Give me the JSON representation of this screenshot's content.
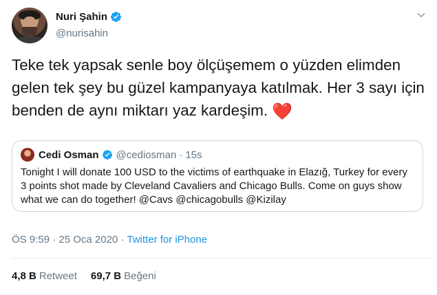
{
  "author": {
    "display_name": "Nuri Şahin",
    "handle": "@nurisahin"
  },
  "tweet": {
    "text": "Teke tek yapsak senle boy ölçüşemem o yüzden elimden gelen tek şey bu güzel kampanyaya katılmak. Her 3 sayı için benden de aynı miktarı yaz kardeşim.",
    "emoji": "❤️"
  },
  "quoted": {
    "display_name": "Cedi Osman",
    "handle": "@cediosman",
    "separator": "·",
    "time": "15s",
    "text": "Tonight I will donate 100 USD to the victims of earthquake in Elazığ, Turkey for every 3 points shot made by Cleveland Cavaliers and Chicago Bulls. Come on guys show what we can do together! @Cavs @chicagobulls @Kizilay"
  },
  "meta": {
    "time": "ÖS 9:59",
    "separator": " · ",
    "date": "25 Oca 2020",
    "source": "Twitter for iPhone"
  },
  "stats": {
    "retweets_count": "4,8 B",
    "retweets_label": "Retweet",
    "likes_count": "69,7 B",
    "likes_label": "Beğeni"
  },
  "icons": {
    "verified_color": "#1da1f2",
    "link_color": "#1b95e0"
  }
}
